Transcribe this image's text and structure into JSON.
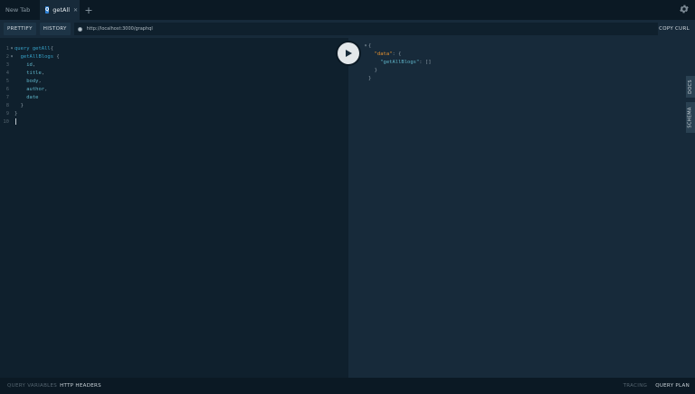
{
  "tabs": [
    {
      "label": "New Tab",
      "active": false
    },
    {
      "label": "getAll",
      "active": true,
      "badge": "Q"
    }
  ],
  "tab_add": "+",
  "toolbar": {
    "prettify": "PRETTIFY",
    "history": "HISTORY",
    "url": "http://localhost:3000/graphql",
    "copy_curl": "COPY CURL"
  },
  "query_lines": [
    {
      "n": "1",
      "fold": "▾",
      "tokens": [
        {
          "t": "query ",
          "c": "kw"
        },
        {
          "t": "getAll",
          "c": "fn"
        },
        {
          "t": "{",
          "c": "pnc"
        }
      ]
    },
    {
      "n": "2",
      "fold": "▾",
      "tokens": [
        {
          "t": "  getAllBlogs",
          "c": "fn"
        },
        {
          "t": " {",
          "c": "pnc"
        }
      ]
    },
    {
      "n": "3",
      "fold": "",
      "tokens": [
        {
          "t": "    id",
          "c": "fld"
        },
        {
          "t": ",",
          "c": "pnc"
        }
      ]
    },
    {
      "n": "4",
      "fold": "",
      "tokens": [
        {
          "t": "    title",
          "c": "fld"
        },
        {
          "t": ",",
          "c": "pnc"
        }
      ]
    },
    {
      "n": "5",
      "fold": "",
      "tokens": [
        {
          "t": "    body",
          "c": "fld"
        },
        {
          "t": ",",
          "c": "pnc"
        }
      ]
    },
    {
      "n": "6",
      "fold": "",
      "tokens": [
        {
          "t": "    author",
          "c": "fld"
        },
        {
          "t": ",",
          "c": "pnc"
        }
      ]
    },
    {
      "n": "7",
      "fold": "",
      "tokens": [
        {
          "t": "    date",
          "c": "fld"
        }
      ]
    },
    {
      "n": "8",
      "fold": "",
      "tokens": [
        {
          "t": "  }",
          "c": "pnc"
        }
      ]
    },
    {
      "n": "9",
      "fold": "",
      "tokens": [
        {
          "t": "}",
          "c": "pnc"
        }
      ]
    },
    {
      "n": "10",
      "fold": "",
      "tokens": []
    }
  ],
  "result_lines": [
    {
      "fold": "▾",
      "tokens": [
        {
          "t": "{",
          "c": "pnc"
        }
      ]
    },
    {
      "fold": "",
      "tokens": [
        {
          "t": "  \"data\"",
          "c": "key"
        },
        {
          "t": ": {",
          "c": "pnc"
        }
      ]
    },
    {
      "fold": "",
      "tokens": [
        {
          "t": "    \"getAllBlogs\"",
          "c": "str"
        },
        {
          "t": ": []",
          "c": "pnc"
        }
      ]
    },
    {
      "fold": "",
      "tokens": [
        {
          "t": "  }",
          "c": "pnc"
        }
      ]
    },
    {
      "fold": "",
      "tokens": [
        {
          "t": "}",
          "c": "pnc"
        }
      ]
    }
  ],
  "side_tabs": {
    "docs": "DOCS",
    "schema": "SCHEMA"
  },
  "footer": {
    "query_variables": "QUERY VARIABLES",
    "http_headers": "HTTP HEADERS",
    "tracing": "TRACING",
    "query_plan": "QUERY PLAN"
  }
}
